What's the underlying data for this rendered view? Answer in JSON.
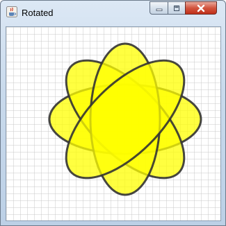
{
  "window": {
    "title": "Rotated",
    "app_icon": "java-cup-icon"
  },
  "controls": {
    "minimize_icon": "minimize-icon",
    "maximize_icon": "maximize-icon",
    "close_icon": "close-icon"
  },
  "canvas": {
    "grid": true,
    "shape_fill": "#ffff00",
    "shape_fill_opacity": 0.75,
    "shape_stroke": "#333333",
    "grid_color": "#c8c8c8",
    "ellipse_rotations_deg": [
      0,
      45,
      90,
      135
    ]
  }
}
